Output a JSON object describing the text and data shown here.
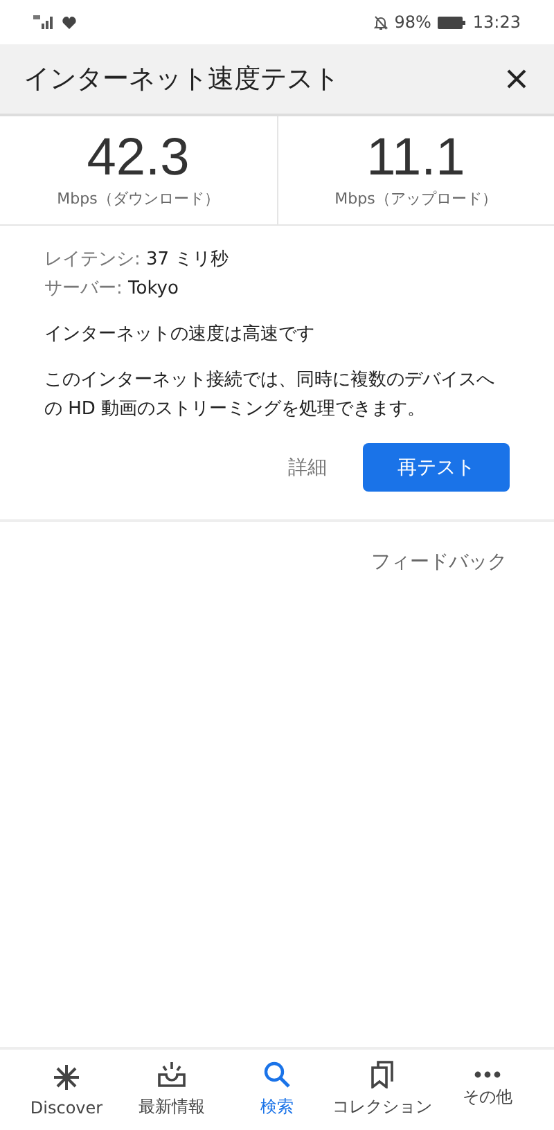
{
  "status_bar": {
    "battery": "98%",
    "time": "13:23"
  },
  "header": {
    "title": "インターネット速度テスト"
  },
  "speeds": [
    {
      "value": "42.3",
      "unit": "Mbps（ダウンロード）"
    },
    {
      "value": "11.1",
      "unit": "Mbps（アップロード）"
    }
  ],
  "details": [
    {
      "label": "レイテンシ:",
      "value": "37 ミリ秒"
    },
    {
      "label": "サーバー:",
      "value": "Tokyo"
    }
  ],
  "headline": "インターネットの速度は高速です",
  "description": "このインターネット接続では、同時に複数のデバイスへの HD 動画のストリーミングを処理できます。",
  "buttons": {
    "details": "詳細",
    "retest": "再テスト"
  },
  "feedback": "フィードバック",
  "bottom_nav": [
    {
      "kind": "discover",
      "label": "Discover",
      "selected": false
    },
    {
      "kind": "updates",
      "label": "最新情報",
      "selected": false
    },
    {
      "kind": "search",
      "label": "検索",
      "selected": true
    },
    {
      "kind": "collections",
      "label": "コレクション",
      "selected": false
    },
    {
      "kind": "more",
      "label": "その他",
      "selected": false
    }
  ]
}
